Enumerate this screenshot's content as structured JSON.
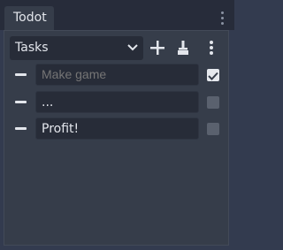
{
  "panel": {
    "tab_label": "Todot"
  },
  "toolbar": {
    "list_select_value": "Tasks"
  },
  "todos": [
    {
      "text": "",
      "placeholder": "Make game",
      "checked": true
    },
    {
      "text": "...",
      "placeholder": "",
      "checked": false
    },
    {
      "text": "Profit!",
      "placeholder": "",
      "checked": false
    }
  ],
  "colors": {
    "background": "#333b4f",
    "tabbar": "#272c3a",
    "panel": "#363d4a",
    "field": "#272c38",
    "text": "#e3e6ec",
    "placeholder": "#8a92a0"
  }
}
